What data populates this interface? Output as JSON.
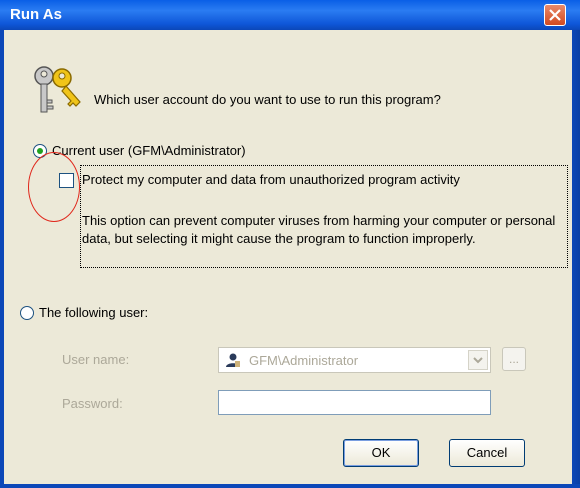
{
  "window": {
    "title": "Run As"
  },
  "prompt": "Which user account do you want to use to run this program?",
  "current_user": {
    "label": "Current user (GFM\\Administrator)",
    "selected": true
  },
  "protect": {
    "label": "Protect my computer and data from unauthorized program activity",
    "checked": false,
    "description": "This option can prevent computer viruses from harming your computer or personal data, but selecting it might cause the program to function improperly."
  },
  "following_user": {
    "label": "The following user:",
    "selected": false
  },
  "fields": {
    "username_label": "User name:",
    "username_value": "GFM\\Administrator",
    "password_label": "Password:",
    "browse_label": "..."
  },
  "buttons": {
    "ok": "OK",
    "cancel": "Cancel"
  },
  "icons": {
    "title_close": "close-icon",
    "keys": "keys-icon",
    "user": "user-icon"
  },
  "colors": {
    "titlebar": "#0a5fe6",
    "dialog_bg": "#ece9d8",
    "highlight_circle": "#e0281c"
  }
}
